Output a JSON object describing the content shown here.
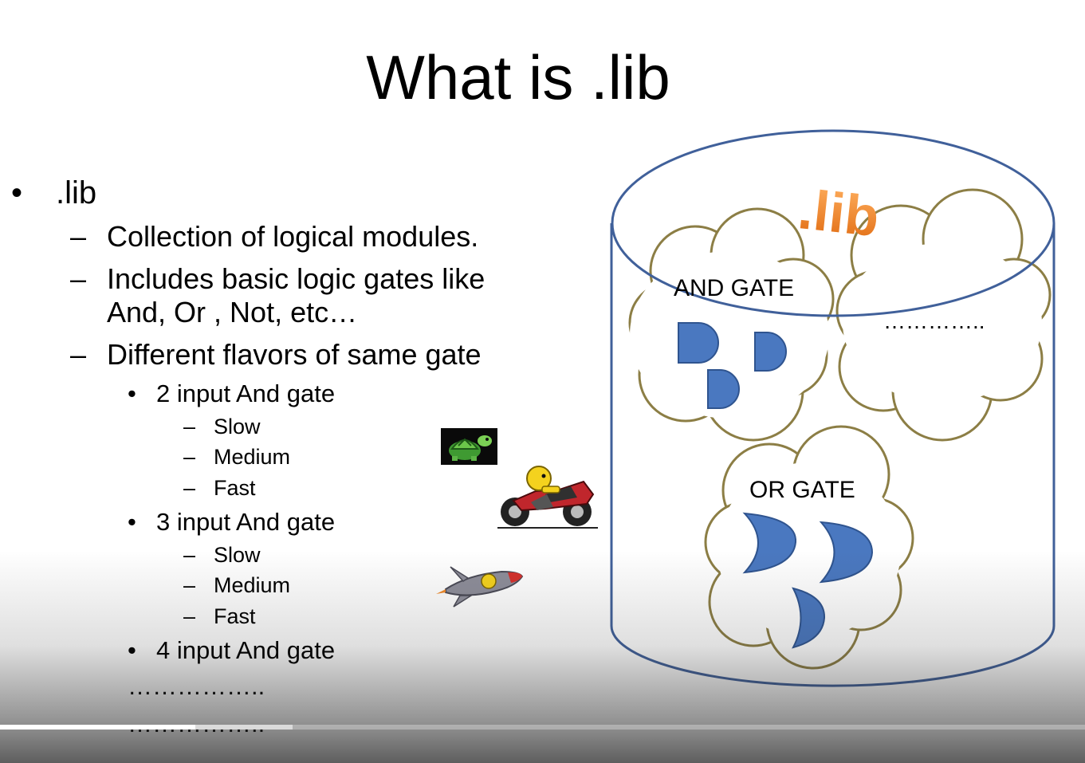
{
  "slide": {
    "title": "What is .lib",
    "bullet_marker": "•",
    "dash_marker": "–",
    "bullet_top": ".lib",
    "item_collection": "Collection of logical modules.",
    "item_includes_line1": "Includes basic logic gates like",
    "item_includes_line2": "And, Or , Not, etc…",
    "item_flavors": "Different  flavors of same gate",
    "sub_2input": "2 input And gate",
    "sub_3input": "3 input And gate",
    "sub_4input": "4 input And gate",
    "speed_slow": "Slow",
    "speed_medium": "Medium",
    "speed_fast": "Fast",
    "ellipsis_1": "……………..",
    "ellipsis_2": "……………..",
    "db_title": ".lib",
    "cloud_and_label": "AND GATE",
    "cloud_other_label": "…………..",
    "cloud_or_label": "OR GATE"
  },
  "colors": {
    "gate_fill": "#4a78c0",
    "gate_stroke": "#2f548f",
    "cylinder_stroke": "#40609a",
    "cloud_stroke": "#8c7e45",
    "lib_orange": "#f08a2a"
  },
  "icons": {
    "slow": "turtle-icon",
    "medium": "motorbike-icon",
    "fast": "rocket-icon"
  },
  "video": {
    "played_fraction": 0.18,
    "buffered_fraction": 0.27
  }
}
